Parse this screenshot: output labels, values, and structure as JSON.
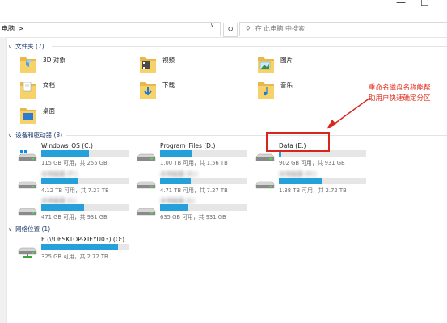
{
  "window": {
    "minimize_icon": "—",
    "maximize_icon": "☐"
  },
  "address": {
    "path": "电脑",
    "separator": ">",
    "dropdown_icon": "∨",
    "refresh_icon": "↻",
    "search_placeholder": "在 此电脑 中搜索",
    "search_icon": "⚲"
  },
  "folders_group": {
    "chevron": "∨",
    "title": "文件夹 (7)",
    "items": [
      {
        "label": "3D 对象",
        "icon": "3d-objects-folder-icon"
      },
      {
        "label": "视频",
        "icon": "videos-folder-icon"
      },
      {
        "label": "图片",
        "icon": "pictures-folder-icon"
      },
      {
        "label": "文档",
        "icon": "documents-folder-icon"
      },
      {
        "label": "下载",
        "icon": "downloads-folder-icon"
      },
      {
        "label": "音乐",
        "icon": "music-folder-icon"
      },
      {
        "label": "桌面",
        "icon": "desktop-folder-icon"
      }
    ]
  },
  "devices_group": {
    "chevron": "∨",
    "title": "设备和驱动器 (8)",
    "drives": [
      {
        "name": "Windows_OS (C:)",
        "size": "115 GB 可用，共 255 GB",
        "used_fraction": 0.55,
        "blurred": false
      },
      {
        "name": "Program_Files (D:)",
        "size": "1.00 TB 可用，共 1.56 TB",
        "used_fraction": 0.36,
        "blurred": false
      },
      {
        "name": "Data (E:)",
        "size": "902 GB 可用，共 931 GB",
        "used_fraction": 0.03,
        "blurred": false
      },
      {
        "name": "本地磁盘 (F:)",
        "size": "4.12 TB 可用，共 7.27 TB",
        "used_fraction": 0.43,
        "blurred": true
      },
      {
        "name": "本地磁盘 (G:)",
        "size": "4.71 TB 可用，共 7.27 TB",
        "used_fraction": 0.35,
        "blurred": true
      },
      {
        "name": "本地磁盘 (H:)",
        "size": "1.38 TB 可用，共 2.72 TB",
        "used_fraction": 0.49,
        "blurred": true
      },
      {
        "name": "本地磁盘 (I:)",
        "size": "471 GB 可用，共 931 GB",
        "used_fraction": 0.49,
        "blurred": true
      },
      {
        "name": "本地磁盘 (J:)",
        "size": "635 GB 可用，共 931 GB",
        "used_fraction": 0.32,
        "blurred": true
      }
    ]
  },
  "network_group": {
    "chevron": "∨",
    "title": "网络位置 (1)",
    "drives": [
      {
        "name": "E (\\\\DESKTOP-XIEYU03) (O:)",
        "size": "325 GB 可用，共 2.72 TB",
        "used_fraction": 0.88
      }
    ]
  },
  "annotation": {
    "text_line1": "重命名磁盘名称能帮",
    "text_line2": "助用户快速确定分区",
    "color": "#e0301e"
  },
  "colors": {
    "accent": "#26a0da",
    "group_header": "#1e3a6e",
    "highlight": "#d9261c"
  }
}
